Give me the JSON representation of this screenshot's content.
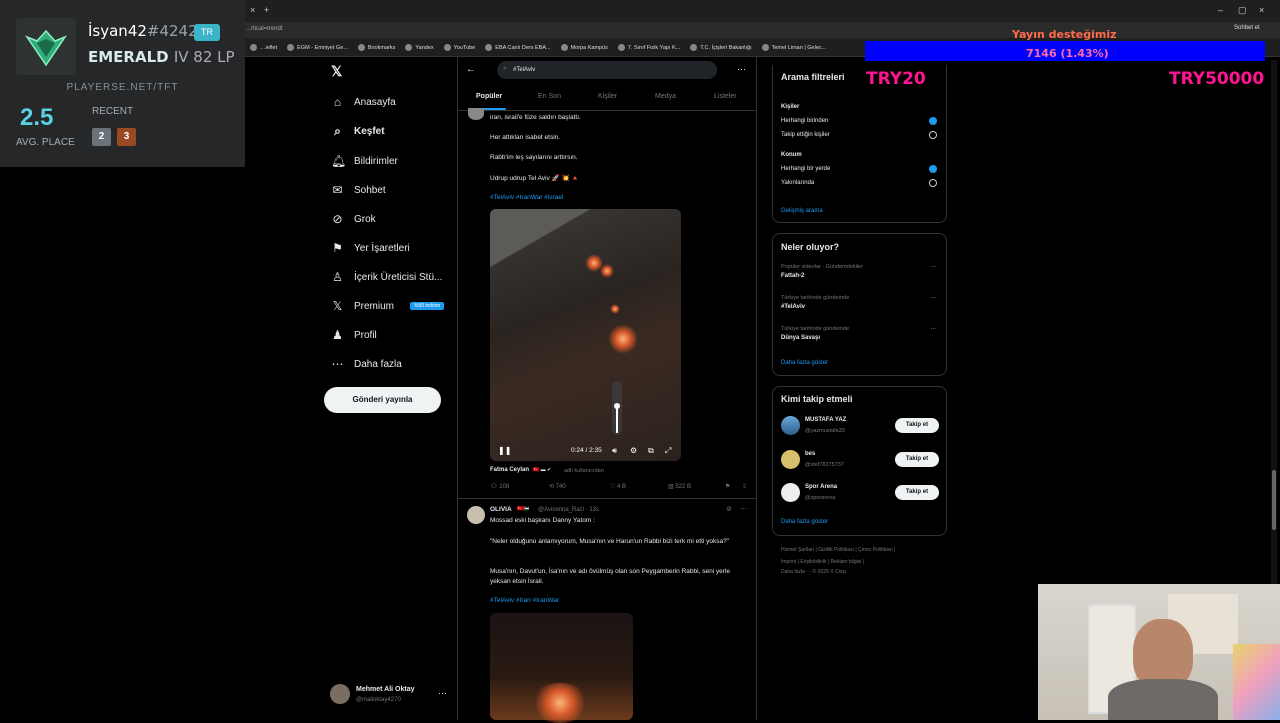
{
  "browser": {
    "address": "...rtical=trendt",
    "bookmarks": [
      "…ieflet",
      "EGM - Emniyet Ge...",
      "Bookmarks",
      "Yandex",
      "YouTube",
      "EBA Canlı Ders EBA...",
      "Morpa Kampüs",
      "7. Sınıf Fizik Yapı K...",
      "T.C. İçişleri Bakanlığı",
      "Temel Liman | Gelec..."
    ],
    "extensions_label": "Sohbet et"
  },
  "tft": {
    "name": "İsyan42",
    "tag": "#4242",
    "region": "TR",
    "rank_tier": "EMERALD",
    "rank_div": "IV 82 LP",
    "site": "PLAYERSE.NET/TFT",
    "avg_place": "2.5",
    "avg_label": "AVG. PLACE",
    "recent_label": "RECENT",
    "recent": [
      "2",
      "3"
    ]
  },
  "sidebar": {
    "items": [
      {
        "label": "Anasayfa"
      },
      {
        "label": "Keşfet"
      },
      {
        "label": "Bildirimler"
      },
      {
        "label": "Sohbet"
      },
      {
        "label": "Grok"
      },
      {
        "label": "Yer İşaretleri"
      },
      {
        "label": "İçerik Üreticisi Stü..."
      },
      {
        "label": "Premium"
      },
      {
        "label": "Profil"
      },
      {
        "label": "Daha fazla"
      }
    ],
    "premium_badge": "%50 indirim",
    "post_button": "Gönderi yayınla",
    "account_name": "Mehmet Ali Oktay",
    "account_handle": "@malioktay4270"
  },
  "center": {
    "search_value": "#TelAviv",
    "tabs": [
      "Popüler",
      "En Son",
      "Kişiler",
      "Medya",
      "Listeler"
    ],
    "tweet1": {
      "lines": [
        "iran, israil'e füze saldırı başlattı.",
        "Her attıkları isabet etsin.",
        "Rabb'im leş sayılarını arttırsın.",
        "Udrup udrup Tel Aviv 🚀 💥 🔺"
      ],
      "hashtags": "#TelAviv #IranWar #israel",
      "video_time": "0:24 / 2:35",
      "author": "Fatma Ceylan",
      "author_note": "adlı kullanıcıdan",
      "replies": "108",
      "reposts": "740",
      "likes": "4 B",
      "views": "522 B"
    },
    "tweet2": {
      "author": "OLIVIA",
      "handle": "@Avicenna_Razi · 13s",
      "line1": "Mossad eski başkanı Danny Yatom :",
      "quote": "\"Neler olduğunu anlamıyorum, Musa'nın ve Harun'un Rabbi bizi terk mi etti yoksa?\"",
      "line3": "Musa'nın, Davut'un, İsa'nın ve adı övülmüş olan son Peygamberin Rabbi, seni yerle yeksan etsin İsrail.",
      "hashtags": "#TelAviv #Iran #IranWar"
    }
  },
  "right": {
    "filters": {
      "title": "Arama filtreleri",
      "people_label": "Kişiler",
      "people_opts": [
        "Herhangi birinden",
        "Takip ettiğin kişiler"
      ],
      "location_label": "Konum",
      "location_opts": [
        "Herhangi bir yerde",
        "Yakınlarında"
      ],
      "advanced": "Gelişmiş arama"
    },
    "trends": {
      "title": "Neler oluyor?",
      "items": [
        {
          "context": "Popüler videolar · Gündemdekiler",
          "topic": "Fattah-2"
        },
        {
          "context": "Türkiye tarihinde gündemde",
          "topic": "#TelAviv"
        },
        {
          "context": "Türkiye tarihinde gündemde",
          "topic": "Dünya Savaşı"
        }
      ],
      "more": "Daha fazla göster"
    },
    "follow": {
      "title": "Kimi takip etmeli",
      "users": [
        {
          "name": "MUSTAFA YAZ",
          "handle": "@yazmustafa33"
        },
        {
          "name": "bes",
          "handle": "@stef78275737"
        },
        {
          "name": "Spor Arena",
          "handle": "@sporarena"
        }
      ],
      "button": "Takip et",
      "more": "Daha fazla göster"
    },
    "footer": {
      "line1": "Hizmet Şartları | Gizlilik Politikası | Çerez Politikası |",
      "line2": "Imprint | Erişilebilirlik | Reklam bilgisi |",
      "line3": "Daha fazla ··· © 2025 X Corp."
    }
  },
  "overlay": {
    "donate_title": "Yayın desteğimiz",
    "donate_value": "7146 (1.43%)",
    "try20": "TRY20",
    "try50000": "TRY50000"
  },
  "colors": {
    "accent": "#1d9bf0",
    "tft_region": "#3ab5c8",
    "neon": "#ff1493",
    "donate_bar": "#0000ff"
  }
}
